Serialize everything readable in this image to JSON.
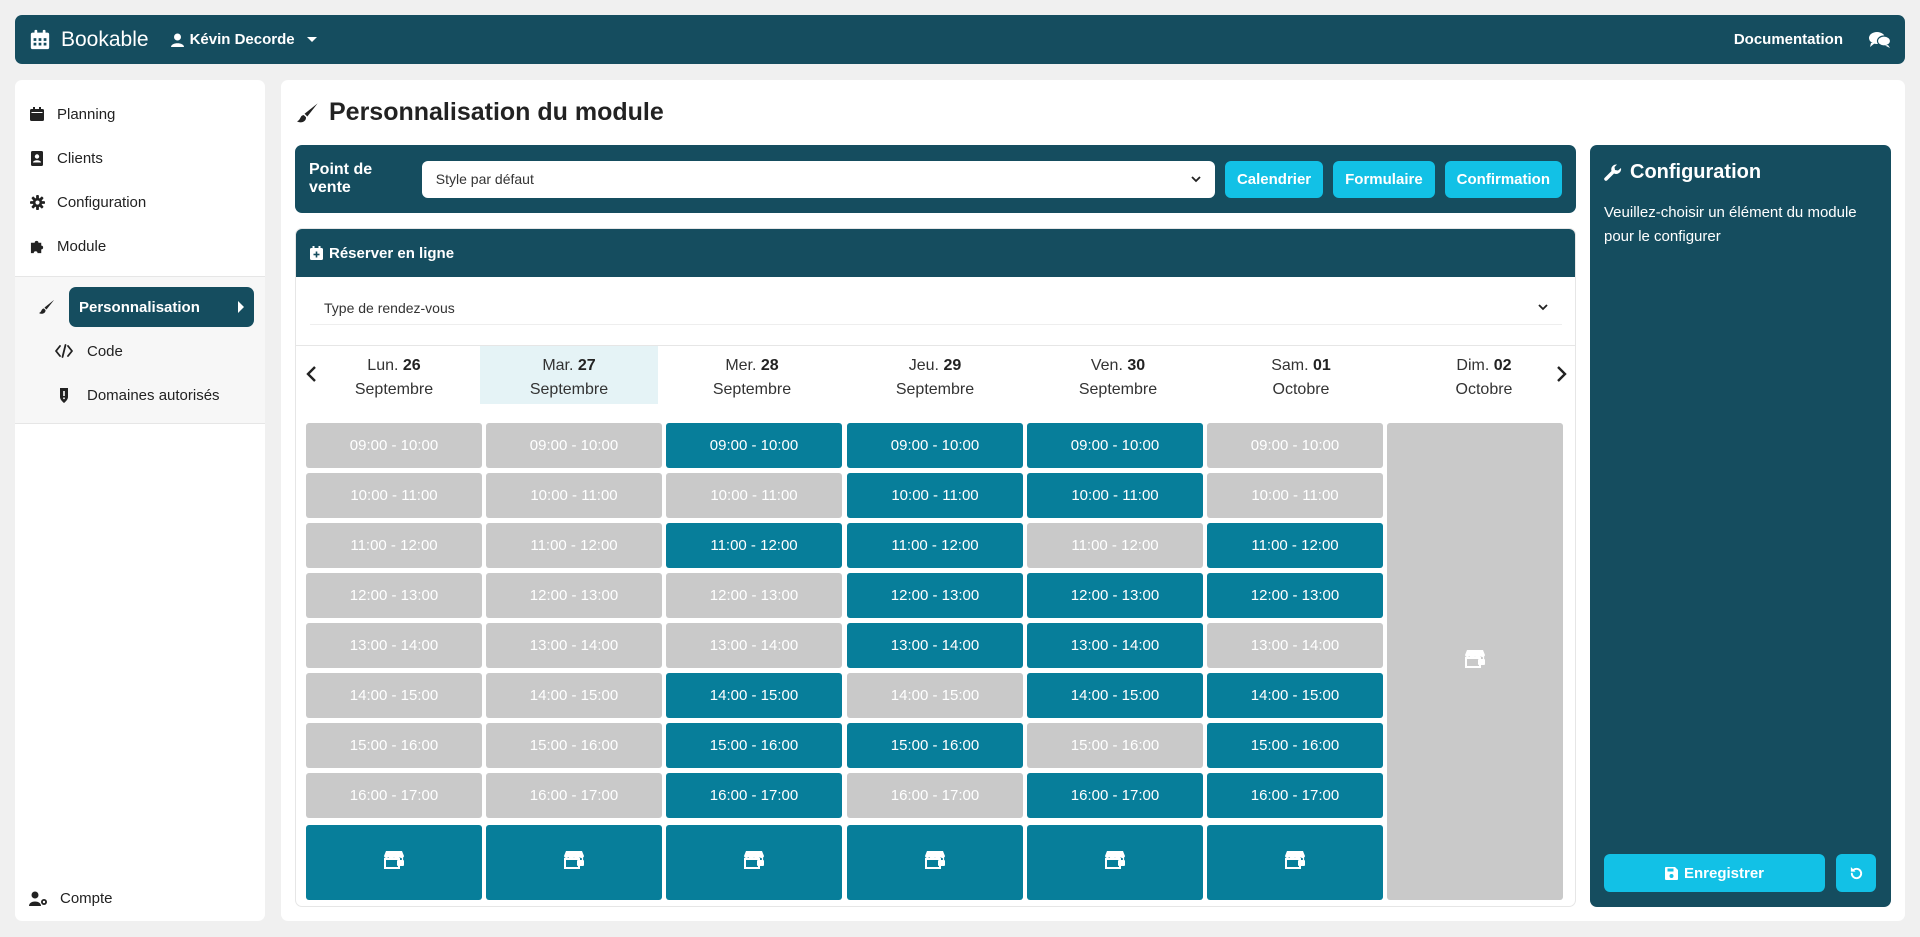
{
  "navbar": {
    "brand": "Bookable",
    "user": "Kévin Decorde",
    "documentation": "Documentation"
  },
  "sidebar": {
    "items": [
      {
        "label": "Planning",
        "icon": "calendar-icon"
      },
      {
        "label": "Clients",
        "icon": "address-book-icon"
      },
      {
        "label": "Configuration",
        "icon": "gear-icon"
      },
      {
        "label": "Module",
        "icon": "puzzle-icon"
      }
    ],
    "sub_items": [
      {
        "label": "Personnalisation",
        "icon": "brush-icon",
        "active": true
      },
      {
        "label": "Code",
        "icon": "code-icon"
      },
      {
        "label": "Domaines autorisés",
        "icon": "shield-icon"
      }
    ],
    "account": "Compte"
  },
  "main": {
    "title": "Personnalisation du module",
    "pos_label": "Point de vente",
    "pos_select": "Style par défaut",
    "buttons": {
      "calendar": "Calendrier",
      "form": "Formulaire",
      "confirmation": "Confirmation"
    }
  },
  "booking": {
    "header": "Réserver en ligne",
    "type_placeholder": "Type de rendez-vous",
    "days": [
      {
        "dow": "Lun.",
        "num": "26",
        "month": "Septembre",
        "selected": false
      },
      {
        "dow": "Mar.",
        "num": "27",
        "month": "Septembre",
        "selected": true
      },
      {
        "dow": "Mer.",
        "num": "28",
        "month": "Septembre",
        "selected": false
      },
      {
        "dow": "Jeu.",
        "num": "29",
        "month": "Septembre",
        "selected": false
      },
      {
        "dow": "Ven.",
        "num": "30",
        "month": "Septembre",
        "selected": false
      },
      {
        "dow": "Sam.",
        "num": "01",
        "month": "Octobre",
        "selected": false
      },
      {
        "dow": "Dim.",
        "num": "02",
        "month": "Octobre",
        "selected": false
      }
    ],
    "slots": [
      "09:00 - 10:00",
      "10:00 - 11:00",
      "11:00 - 12:00",
      "12:00 - 13:00",
      "13:00 - 14:00",
      "14:00 - 15:00",
      "15:00 - 16:00",
      "16:00 - 17:00"
    ],
    "availability": [
      [
        false,
        false,
        false,
        false,
        false,
        false,
        false,
        false
      ],
      [
        false,
        false,
        false,
        false,
        false,
        false,
        false,
        false
      ],
      [
        true,
        false,
        true,
        false,
        false,
        true,
        true,
        true
      ],
      [
        true,
        true,
        true,
        true,
        true,
        false,
        true,
        false
      ],
      [
        true,
        true,
        false,
        true,
        true,
        true,
        false,
        true
      ],
      [
        false,
        false,
        true,
        true,
        false,
        true,
        true,
        true
      ]
    ],
    "colors": {
      "available": "#077e9a",
      "unavailable": "#c9c9c9",
      "primary": "#154d5f",
      "accent": "#12c1e6"
    }
  },
  "config": {
    "title": "Configuration",
    "text": "Veuillez-choisir un élément du module pour le configurer",
    "save": "Enregistrer"
  }
}
